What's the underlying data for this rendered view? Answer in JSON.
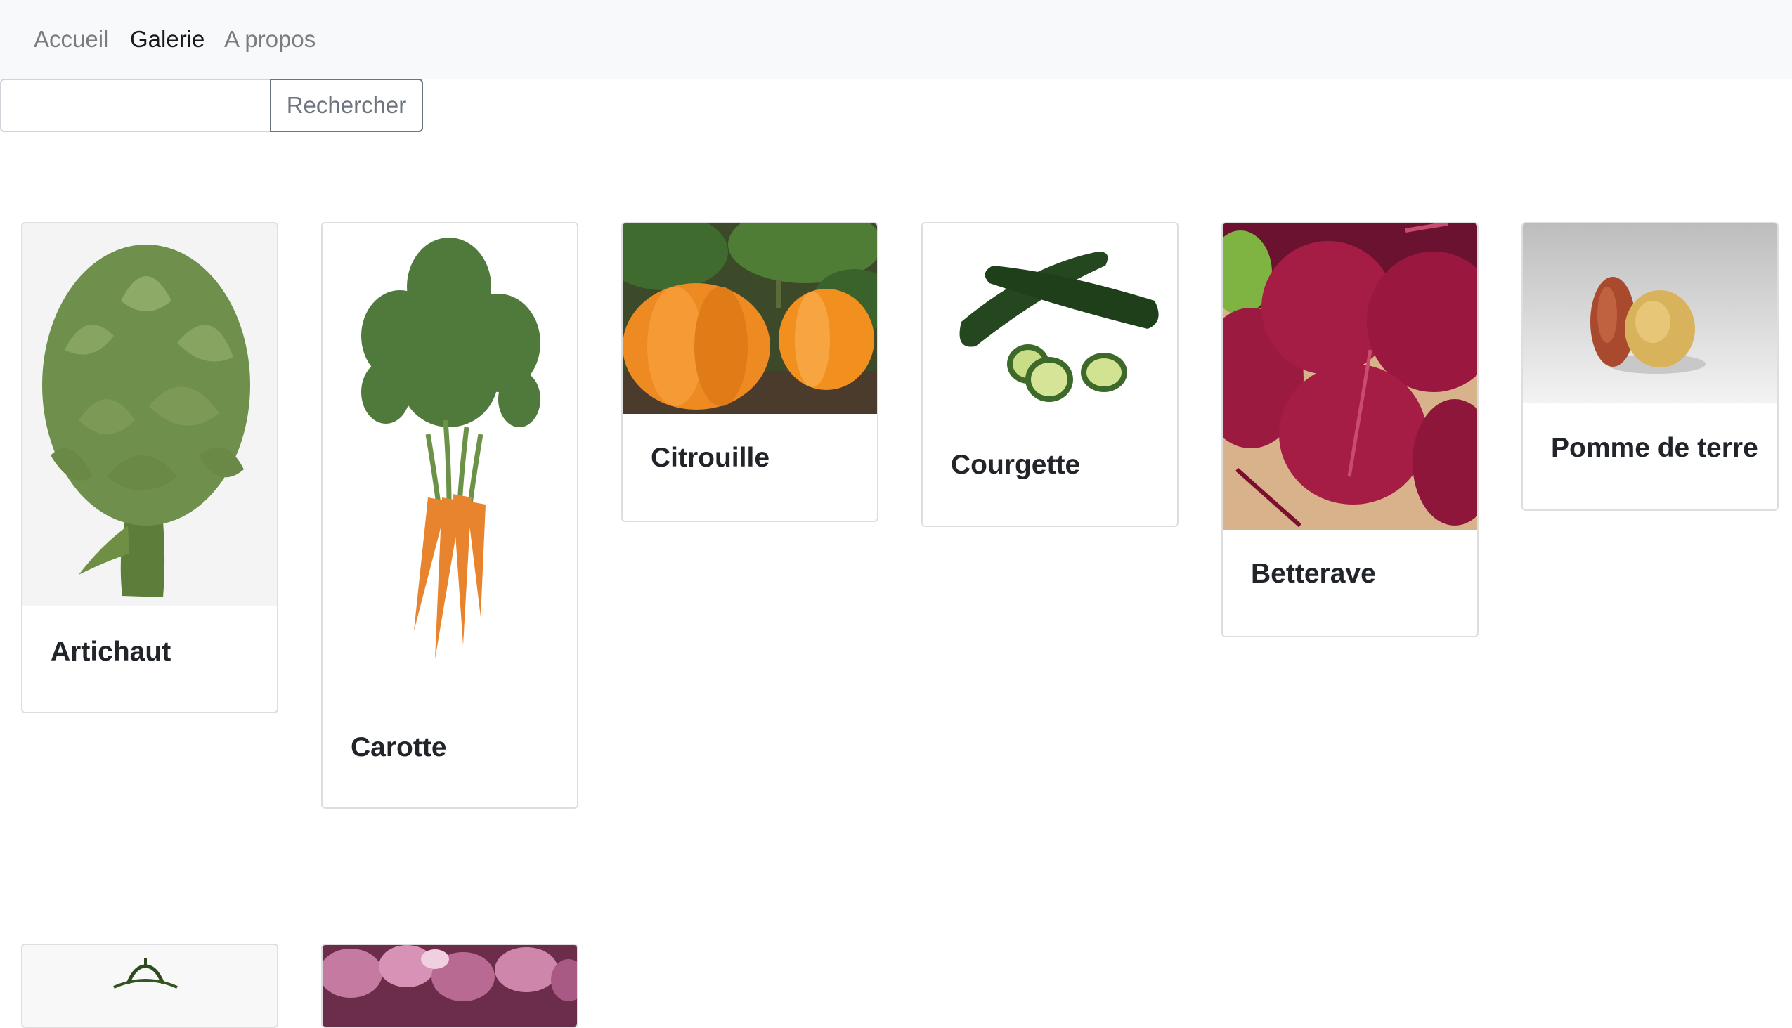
{
  "nav": {
    "links": [
      {
        "label": "Accueil",
        "active": false
      },
      {
        "label": "Galerie",
        "active": true
      },
      {
        "label": "A propos",
        "active": false
      }
    ]
  },
  "search": {
    "value": "",
    "placeholder": "",
    "button_label": "Rechercher"
  },
  "gallery": {
    "cards": [
      {
        "title": "Artichaut",
        "icon": "artichoke-image"
      },
      {
        "title": "Carotte",
        "icon": "carrot-image"
      },
      {
        "title": "Citrouille",
        "icon": "pumpkin-image"
      },
      {
        "title": "Courgette",
        "icon": "zucchini-image"
      },
      {
        "title": "Betterave",
        "icon": "beetroot-image"
      },
      {
        "title": "Pomme de terre",
        "icon": "potato-image"
      },
      {
        "title": "",
        "icon": "tomato-plant-image"
      },
      {
        "title": "",
        "icon": "turnip-image"
      }
    ]
  },
  "colors": {
    "navbar_bg": "#f8f9fa",
    "nav_active": "#1a1a1a",
    "nav_inactive": "#808080",
    "button_outline": "#6c757d",
    "card_border": "#dfdfdf"
  }
}
